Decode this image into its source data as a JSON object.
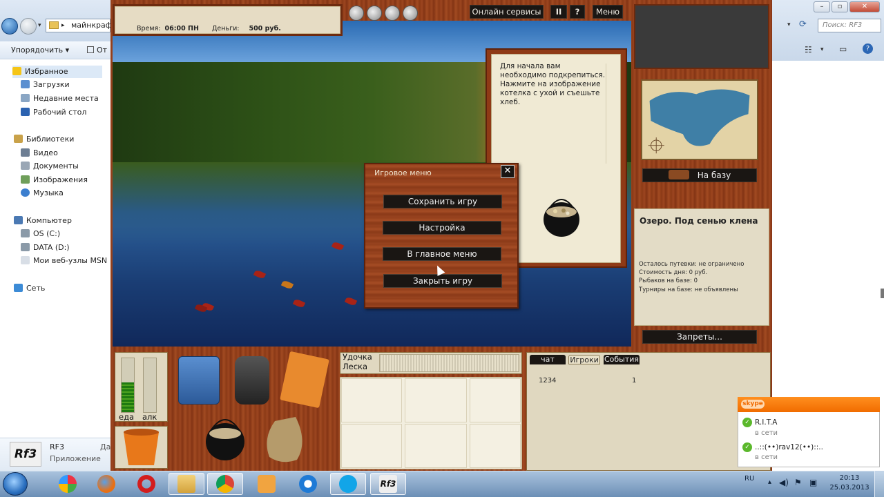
{
  "explorer": {
    "address": "майнкрафт",
    "search_placeholder": "Поиск: RF3",
    "cmd_organize": "Упорядочить ▾",
    "cmd_open": "От",
    "nav": [
      {
        "label": "Избранное"
      },
      {
        "label": "Загрузки"
      },
      {
        "label": "Недавние места"
      },
      {
        "label": "Рабочий стол"
      },
      {
        "label": "Библиотеки"
      },
      {
        "label": "Видео"
      },
      {
        "label": "Документы"
      },
      {
        "label": "Изображения"
      },
      {
        "label": "Музыка"
      },
      {
        "label": "Компьютер"
      },
      {
        "label": "OS (C:)"
      },
      {
        "label": "DATA (D:)"
      },
      {
        "label": "Мои веб-узлы MSN"
      },
      {
        "label": "Сеть"
      }
    ],
    "details": {
      "icon_text": "Rf3",
      "name": "RF3",
      "type": "Приложение",
      "extra": "Да"
    }
  },
  "game": {
    "time_label": "Время:",
    "time_value": "06:00 ПН",
    "money_label": "Деньги:",
    "money_value": "500 руб.",
    "btn_online": "Онлайн сервисы",
    "btn_pause": "II",
    "btn_help": "?",
    "btn_menu": "Меню",
    "message": "Для начала вам необходимо подкрепиться. Нажмите на изображение котелка с ухой и съешьте хлеб.",
    "to_base": "На базу",
    "lake_title": "Озеро. Под сенью клена",
    "lake_lines": [
      "Осталось путевки: не ограничено",
      "Стоимость дня: 0 руб.",
      "Рыбаков на базе: 0",
      "Турниры на базе: не объявлены"
    ],
    "bans": "Запреты...",
    "gauge_food": "еда",
    "gauge_alc": "алк",
    "food_level": 0.55,
    "alc_level": 0,
    "rod_label": "Удочка",
    "line_label": "Леска",
    "tabs": [
      "чат",
      "Игроки",
      "События"
    ],
    "chat_name": "1234",
    "chat_count": "1"
  },
  "menu": {
    "title": "Игровое меню",
    "close": "✕",
    "save": "Сохранить игру",
    "settings": "Настройка",
    "main_menu": "В главное меню",
    "close_game": "Закрыть игру"
  },
  "skype": {
    "logo": "skype",
    "contacts": [
      {
        "name": "R.I.T.A",
        "status": "в сети"
      },
      {
        "name": "..::(••)rav12(••)::..",
        "status": "в сети"
      }
    ]
  },
  "taskbar": {
    "lang": "RU",
    "time": "20:13",
    "date": "25.03.2013"
  },
  "colors": {
    "wood": "#8e3b17",
    "panel": "#e0d8c0",
    "button": "#1a1613",
    "skype": "#f16c00"
  }
}
